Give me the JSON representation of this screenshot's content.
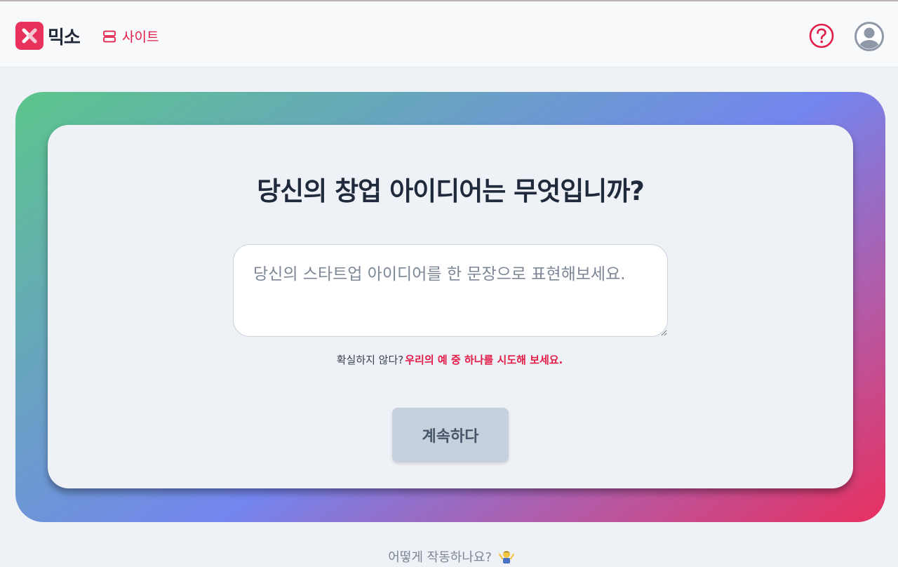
{
  "header": {
    "logo_text": "믹소",
    "site_link_label": "사이트",
    "help_icon": "question-circle-icon",
    "avatar_icon": "user-avatar-icon"
  },
  "main": {
    "question": "당신의 창업 아이디어는 무엇입니까?",
    "idea_placeholder": "당신의 스타트업 아이디어를 한 문장으로 표현해보세요.",
    "idea_value": "",
    "hint_text": "확실하지 않다?",
    "hint_link": "우리의 예 중 하나를 시도해 보세요.",
    "continue_label": "계속하다"
  },
  "footer": {
    "how_it_works": "어떻게 작동하나요?",
    "how_icon": "person-shrugging-icon"
  },
  "colors": {
    "accent": "#e11d48",
    "logo": "#e8325c",
    "gradient": [
      "#5bc58b",
      "#7385ee",
      "#e8305f"
    ]
  }
}
